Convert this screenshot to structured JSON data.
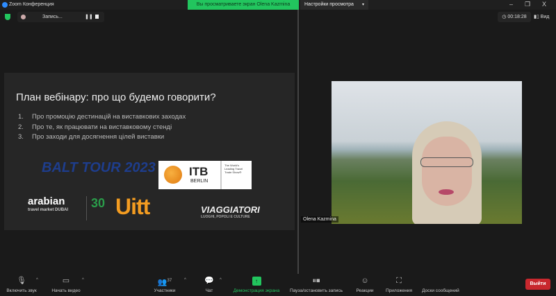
{
  "window": {
    "title": "Zoom Конференция",
    "minimize": "–",
    "maximize": "❐",
    "close": "X"
  },
  "banner": "Вы просматриваете экран Olena Kazmina",
  "view_options": {
    "label": "Настройки просмотра",
    "caret": "▾"
  },
  "recording": {
    "label": "Запись...",
    "pause": "❚❚"
  },
  "timer": "◷ 00:18:28",
  "view_button": "▮▯ Вид",
  "slide": {
    "title": "План вебінару: про що будемо говорити?",
    "items": [
      {
        "num": "1.",
        "text": "Про промоцію дестинацій на виставкових заходах"
      },
      {
        "num": "2.",
        "text": "Про те, як працювати на виставковому стенді"
      },
      {
        "num": "3.",
        "text": "Про заходи для досягнення цілей виставки"
      }
    ],
    "logos": {
      "balt": "BALT TOUR 2023",
      "itb": "ITB",
      "itb_city": "BERLIN",
      "itb_tag": "The World's Leading Travel Trade Show®",
      "atm": "arabian",
      "atm_sub": "travel market DUBAI",
      "atm_years": "30",
      "uitt": "Uitt",
      "viag": "VIAGGIATORI",
      "viag_sub": "LUOGHI, POPOLI E CULTURE"
    }
  },
  "participant": {
    "name": "Olena Kazmina"
  },
  "toolbar": {
    "audio": "Включить звук",
    "video": "Начать видео",
    "participants": "Участники",
    "participants_count": "37",
    "chat": "Чат",
    "share": "Демонстрация экрана",
    "record": "Пауза/остановить запись",
    "reactions": "Реакции",
    "apps": "Приложения",
    "whiteboards": "Доски сообщений",
    "leave": "Выйти",
    "caret": "^"
  }
}
